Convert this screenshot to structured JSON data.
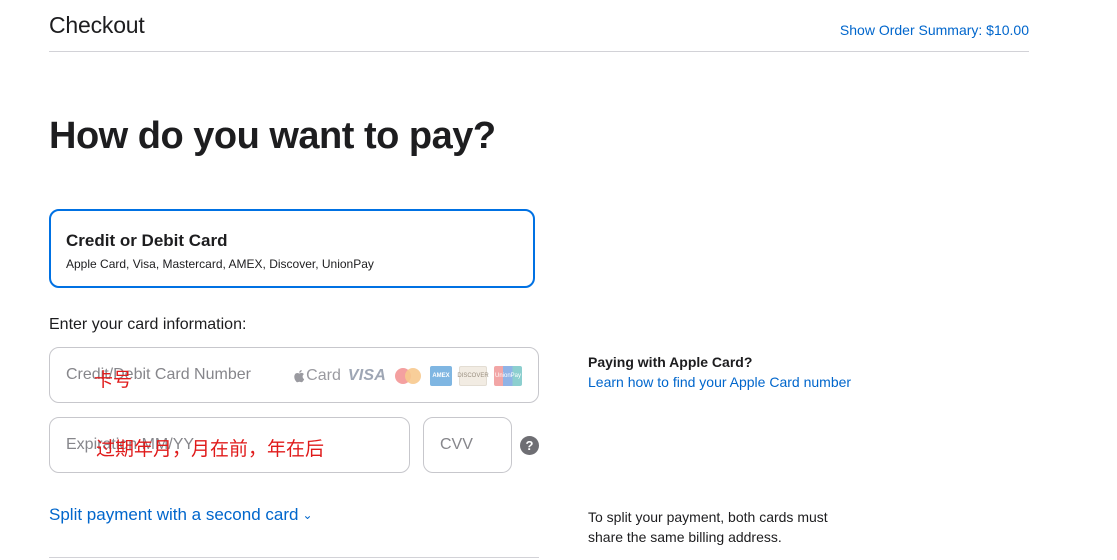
{
  "header": {
    "title": "Checkout",
    "order_summary": "Show Order Summary: $10.00"
  },
  "main": {
    "title": "How do you want to pay?",
    "payment_method": {
      "title": "Credit or Debit Card",
      "subtitle": "Apple Card, Visa, Mastercard, AMEX, Discover, UnionPay",
      "selected": true
    },
    "enter_label": "Enter your card information:",
    "card_number": {
      "placeholder": "Credit/Debit Card Number",
      "annotation": "卡号",
      "brands": [
        "Card",
        "VISA",
        "mastercard",
        "AMEX",
        "DISCOVER",
        "UnionPay"
      ]
    },
    "expiration": {
      "placeholder": "Expiration MM/YY",
      "annotation": "过期年月，月在前，年在后"
    },
    "cvv": {
      "placeholder": "CVV"
    },
    "help_icon": "question-mark-icon",
    "split_link": "Split payment with a second card",
    "split_chevron": "chevron-down-icon"
  },
  "aside": {
    "apple_card_title": "Paying with Apple Card?",
    "apple_card_link": "Learn how to find your Apple Card number",
    "split_note": "To split your payment, both cards must share the same billing address."
  },
  "colors": {
    "accent": "#0071e3",
    "link": "#0066cc",
    "annotation": "#e01b1b",
    "text": "#1d1d1f"
  }
}
